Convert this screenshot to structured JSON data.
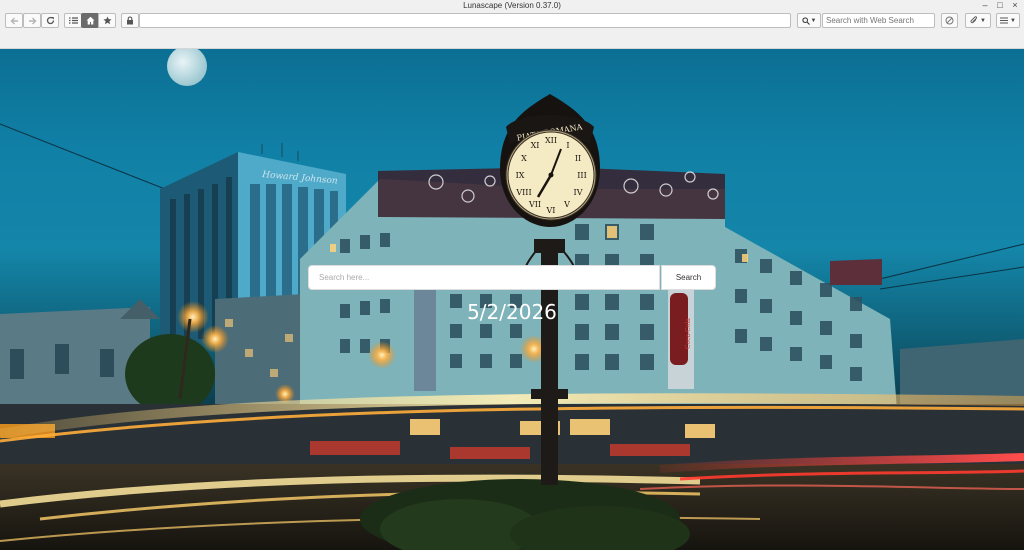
{
  "window": {
    "title": "Lunascape (Version 0.37.0)",
    "minimize_symbol": "–",
    "maximize_symbol": "□",
    "close_symbol": "×"
  },
  "toolbar": {
    "address_value": "",
    "search_engine_icon": "magnifier-icon",
    "web_search_placeholder": "Search with Web Search",
    "buttons": [
      "back-icon",
      "forward-icon",
      "reload-icon",
      "list-icon",
      "home-icon",
      "star-icon",
      "lock-icon",
      "block-icon",
      "paperclip-icon",
      "menu-icon"
    ]
  },
  "scene": {
    "clock_sign": "PIATA ROMANA",
    "building_sign": "Howard Johnson",
    "billboard_text": "Coca-Cola"
  },
  "newtab": {
    "search_placeholder": "Search here...",
    "search_button_label": "Search",
    "date": "5/2/2026"
  }
}
